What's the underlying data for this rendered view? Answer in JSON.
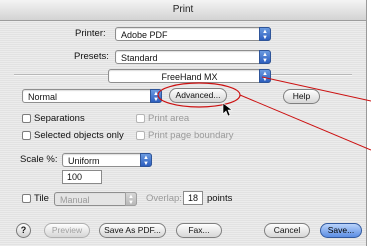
{
  "dialog": {
    "title": "Print"
  },
  "printer": {
    "label": "Printer:",
    "value": "Adobe PDF"
  },
  "presets": {
    "label": "Presets:",
    "value": "Standard"
  },
  "panel_select": {
    "value": "FreeHand MX"
  },
  "mode_select": {
    "value": "Normal"
  },
  "advanced_button": {
    "label": "Advanced..."
  },
  "help_button": {
    "label": "Help"
  },
  "options": {
    "separations": "Separations",
    "print_area": "Print area",
    "selected_only": "Selected objects only",
    "print_page_boundary": "Print page boundary"
  },
  "scale": {
    "label": "Scale %:",
    "mode": "Uniform",
    "value": "100"
  },
  "tile": {
    "label": "Tile",
    "mode": "Manual",
    "overlap_label": "Overlap:",
    "overlap_value": "18",
    "overlap_unit": "points"
  },
  "footer": {
    "help_glyph": "?",
    "preview": "Preview",
    "save_as_pdf": "Save As PDF...",
    "fax": "Fax...",
    "cancel": "Cancel",
    "save": "Save..."
  },
  "colors": {
    "annotation_red": "#cc1111",
    "accent_blue": "#3a6fd0"
  }
}
